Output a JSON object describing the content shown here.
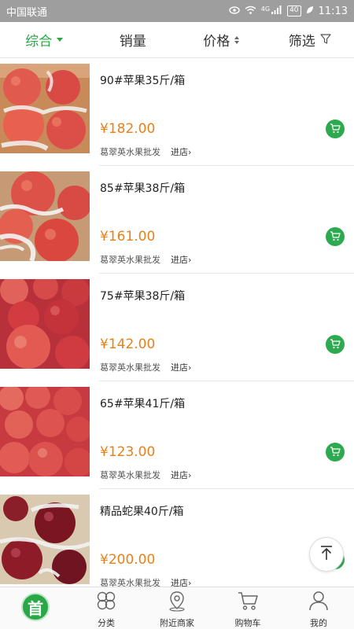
{
  "status_bar": {
    "carrier": "中国联通",
    "signal_label": "4G",
    "battery": "40",
    "time": "11:13"
  },
  "filter_bar": {
    "tabs": [
      {
        "label": "综合",
        "active": true
      },
      {
        "label": "销量",
        "active": false
      },
      {
        "label": "价格",
        "active": false
      },
      {
        "label": "筛选",
        "active": false
      }
    ]
  },
  "products": [
    {
      "title": "90#苹果35斤/箱",
      "price": "¥182.00",
      "shop": "葛翠英水果批发",
      "enter": "进店"
    },
    {
      "title": "85#苹果38斤/箱",
      "price": "¥161.00",
      "shop": "葛翠英水果批发",
      "enter": "进店"
    },
    {
      "title": "75#苹果38斤/箱",
      "price": "¥142.00",
      "shop": "葛翠英水果批发",
      "enter": "进店"
    },
    {
      "title": "65#苹果41斤/箱",
      "price": "¥123.00",
      "shop": "葛翠英水果批发",
      "enter": "进店"
    },
    {
      "title": "精品蛇果40斤/箱",
      "price": "¥200.00",
      "shop": "葛翠英水果批发",
      "enter": "进店"
    }
  ],
  "bottom_nav": {
    "items": [
      {
        "label": "",
        "icon": "home-logo",
        "logo_text": "首"
      },
      {
        "label": "分类",
        "icon": "category-icon"
      },
      {
        "label": "附近商家",
        "icon": "location-pin-icon"
      },
      {
        "label": "购物车",
        "icon": "cart-icon"
      },
      {
        "label": "我的",
        "icon": "user-icon"
      }
    ]
  },
  "colors": {
    "accent": "#27a844",
    "price": "#e8801a",
    "statusbar": "#9e9e9e"
  }
}
